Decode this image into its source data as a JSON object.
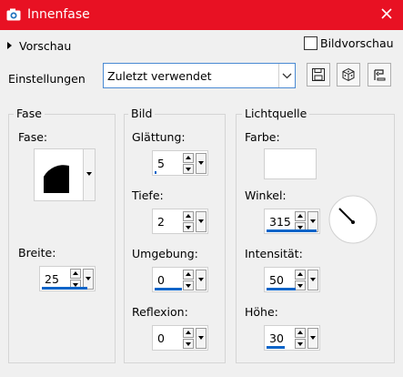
{
  "window": {
    "title": "Innenfase"
  },
  "toolbar": {
    "preview_label": "Vorschau",
    "image_preview_label": "Bildvorschau",
    "image_preview_checked": false,
    "settings_label": "Einstellungen",
    "settings_value": "Zuletzt verwendet"
  },
  "fase_group": {
    "title": "Fase",
    "fase_label": "Fase:",
    "breite_label": "Breite:",
    "breite_value": "25"
  },
  "bild_group": {
    "title": "Bild",
    "glaettung_label": "Glättung:",
    "glaettung_value": "5",
    "tiefe_label": "Tiefe:",
    "tiefe_value": "2",
    "umgebung_label": "Umgebung:",
    "umgebung_value": "0",
    "reflexion_label": "Reflexion:",
    "reflexion_value": "0"
  },
  "licht_group": {
    "title": "Lichtquelle",
    "farbe_label": "Farbe:",
    "farbe_value": "#ffffff",
    "winkel_label": "Winkel:",
    "winkel_value": "315",
    "intensitaet_label": "Intensität:",
    "intensitaet_value": "50",
    "hoehe_label": "Höhe:",
    "hoehe_value": "30"
  },
  "colors": {
    "titlebar": "#e81123",
    "accent": "#0a64c8"
  },
  "icons": [
    "camera-icon",
    "close-icon",
    "save-icon",
    "dice-icon",
    "reset-icon",
    "chevron-down-icon",
    "expand-triangle-icon"
  ]
}
